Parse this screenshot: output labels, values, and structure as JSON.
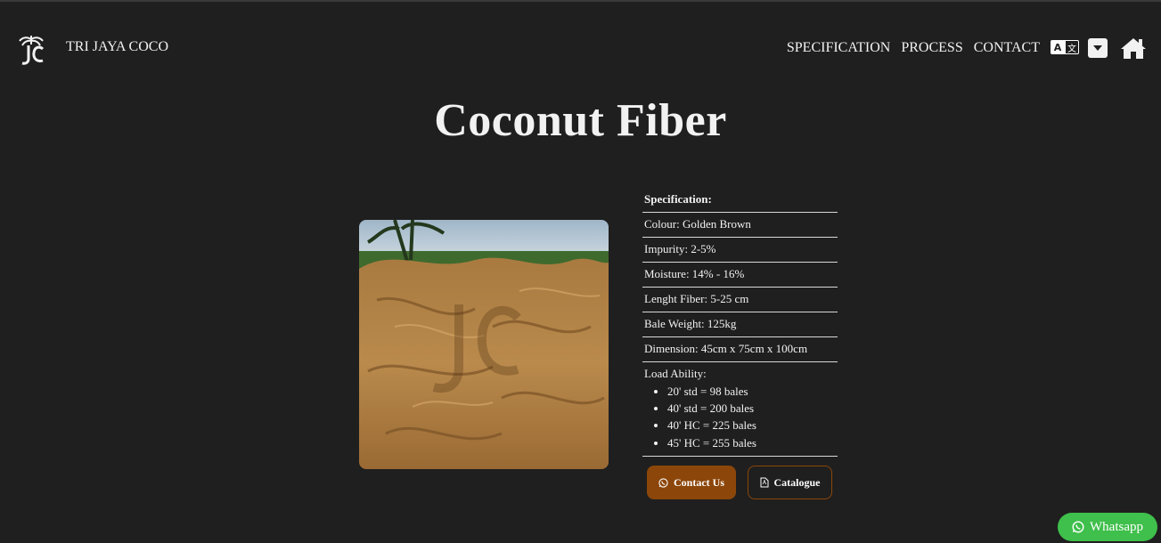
{
  "nav": {
    "brand": "TRI JAYA COCO",
    "links": [
      "SPECIFICATION",
      "PROCESS",
      "CONTACT"
    ],
    "lang_icon": "translate-icon",
    "dropdown_icon": "caret-down-icon",
    "home_icon": "home-icon"
  },
  "page": {
    "title": "Coconut Fiber"
  },
  "spec": {
    "heading": "Specification:",
    "rows": [
      "Colour: Golden Brown",
      "Impurity: 2-5%",
      "Moisture: 14% - 16%",
      "Lenght Fiber: 5-25 cm",
      "Bale Weight: 125kg",
      "Dimension: 45cm x 75cm x 100cm"
    ],
    "load_label": "Load Ability:",
    "load_items": [
      "20' std = 98 bales",
      "40' std = 200 bales",
      "40' HC = 225 bales",
      "45' HC = 255 bales"
    ]
  },
  "buttons": {
    "contact": "Contact Us",
    "catalogue": "Catalogue"
  },
  "whatsapp": "Whatsapp",
  "colors": {
    "background": "#1f1f1f",
    "accent": "#8c4609",
    "whatsapp": "#3fbf4b"
  }
}
